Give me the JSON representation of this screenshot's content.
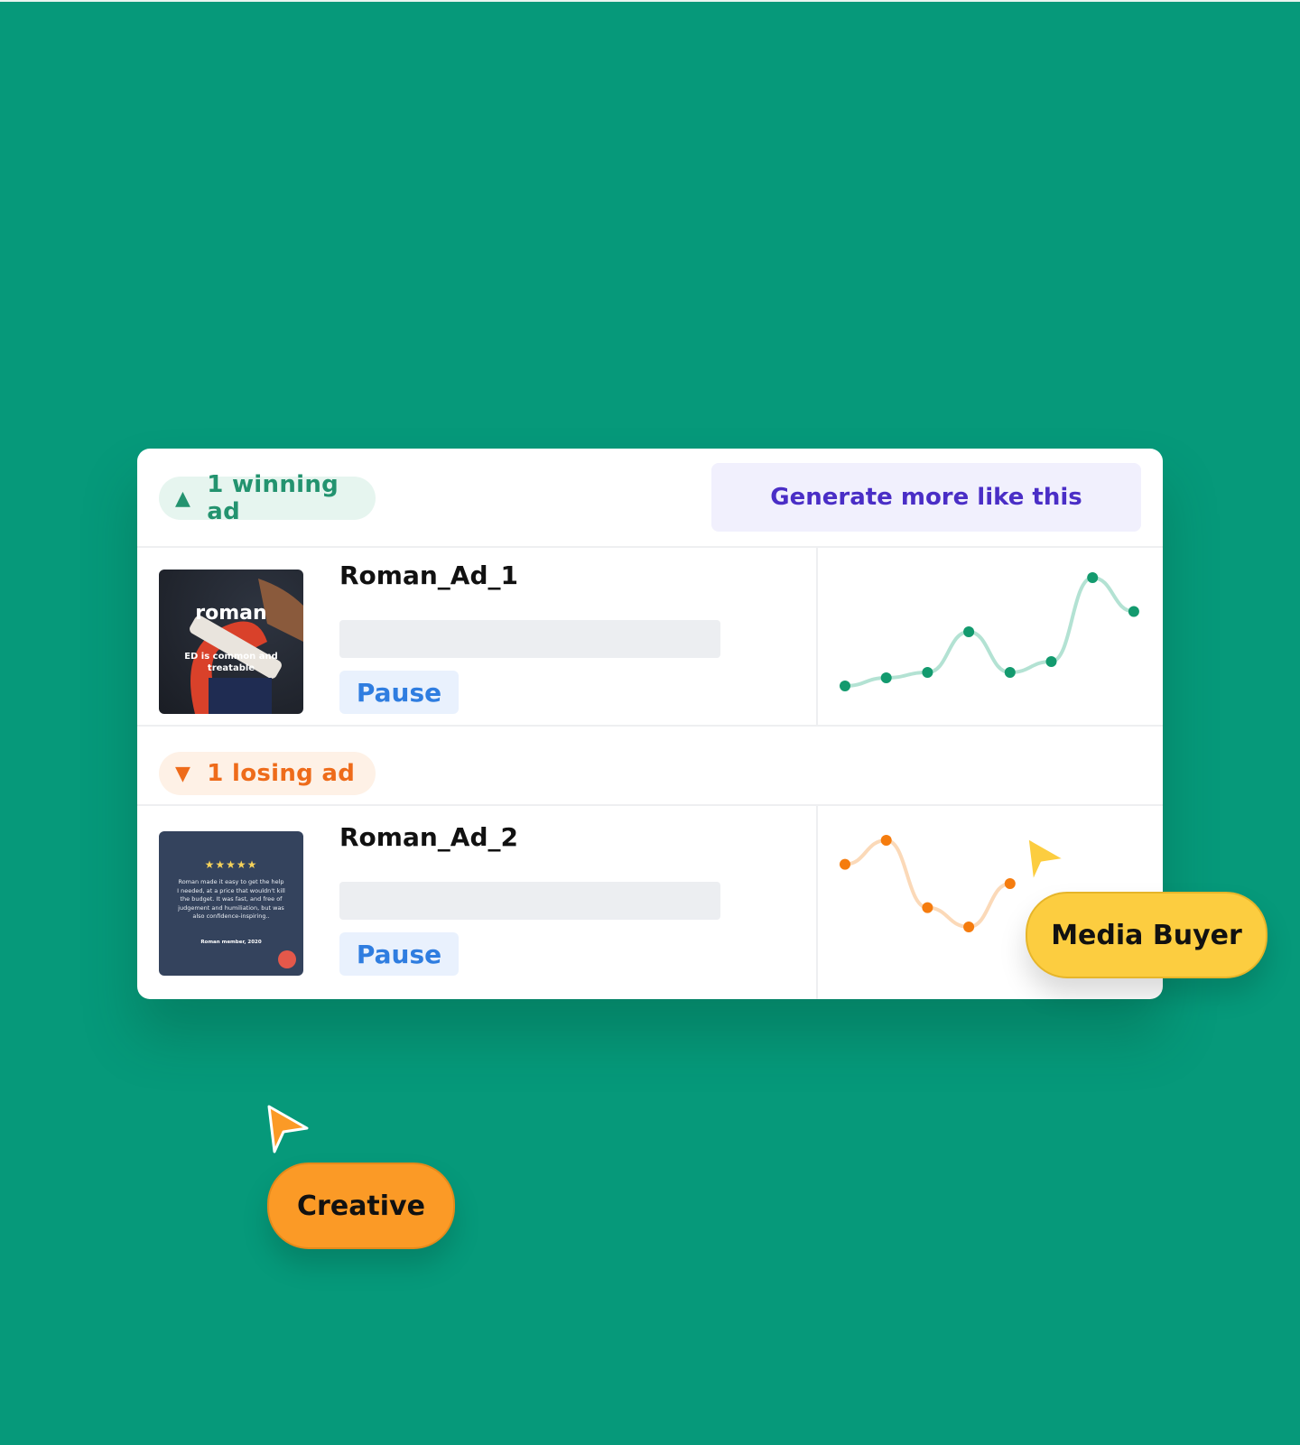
{
  "winning": {
    "label": "1 winning ad",
    "icon": "triangle-up-icon",
    "color": "#23936f",
    "generate_button": "Generate more like this",
    "ad": {
      "name": "Roman_Ad_1",
      "pause_label": "Pause",
      "thumbnail": {
        "brand": "roman",
        "headline": "ED is common and treatable"
      },
      "trend_values": [
        2.0,
        2.6,
        3.0,
        6.0,
        3.0,
        3.8,
        10.0,
        7.5
      ]
    }
  },
  "losing": {
    "label": "1 losing ad",
    "icon": "triangle-down-icon",
    "color": "#ee6b1a",
    "ad": {
      "name": "Roman_Ad_2",
      "pause_label": "Pause",
      "thumbnail": {
        "stars": "★★★★★",
        "quote": "Roman made it easy to get the help I needed, at a price that wouldn't kill the budget. It was fast, and free of judgement and humiliation, but was also confidence-inspiring..",
        "attribution": "Roman member, 2020"
      },
      "trend_values": [
        7.5,
        10.0,
        3.0,
        1.0,
        5.5
      ]
    }
  },
  "cursors": {
    "media_buyer": {
      "label": "Media Buyer",
      "color": "#fccd40"
    },
    "creative": {
      "label": "Creative",
      "color": "#fb9a26"
    }
  }
}
